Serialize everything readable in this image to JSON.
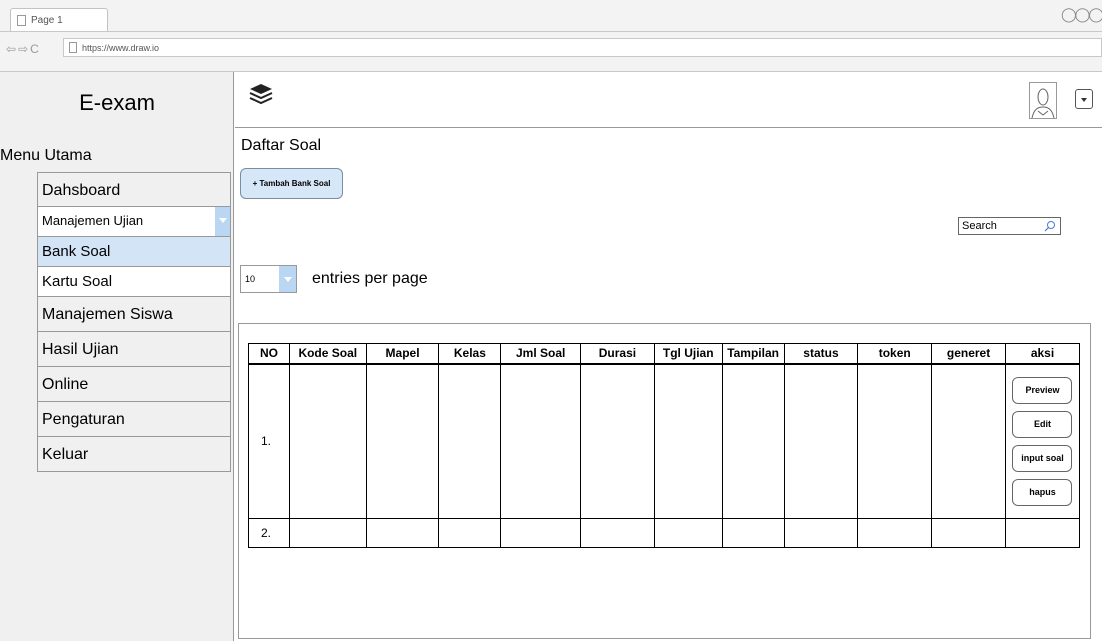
{
  "browser": {
    "tab_title": "Page 1",
    "url": "https://www.draw.io"
  },
  "sidebar": {
    "app_title": "E-exam",
    "menu_title": "Menu Utama",
    "items": [
      {
        "label": "Dahsboard"
      },
      {
        "label": "Manajemen Ujian"
      },
      {
        "label": "Bank Soal"
      },
      {
        "label": "Kartu Soal"
      },
      {
        "label": "Manajemen Siswa"
      },
      {
        "label": "Hasil Ujian"
      },
      {
        "label": "Online"
      },
      {
        "label": "Pengaturan"
      },
      {
        "label": "Keluar"
      }
    ]
  },
  "header": {
    "menu_icon": "layers-icon",
    "avatar_icon": "user-avatar-icon"
  },
  "main": {
    "page_title": "Daftar Soal",
    "add_button_label": "+ Tambah Bank Soal",
    "search_placeholder": "Search",
    "entries_value": "10",
    "entries_label": "entries per page",
    "table": {
      "columns": [
        "NO",
        "Kode Soal",
        "Mapel",
        "Kelas",
        "Jml Soal",
        "Durasi",
        "Tgl Ujian",
        "Tampilan",
        "status",
        "token",
        "generet",
        "aksi"
      ],
      "rows": [
        {
          "no": "1.",
          "actions": [
            "Preview",
            "Edit",
            "input soal",
            "hapus"
          ]
        },
        {
          "no": "2.",
          "actions": []
        }
      ]
    }
  },
  "colors": {
    "accent": "#b9d6f2",
    "selected": "#d4e4f7",
    "button_bg": "#d6e7f8"
  }
}
